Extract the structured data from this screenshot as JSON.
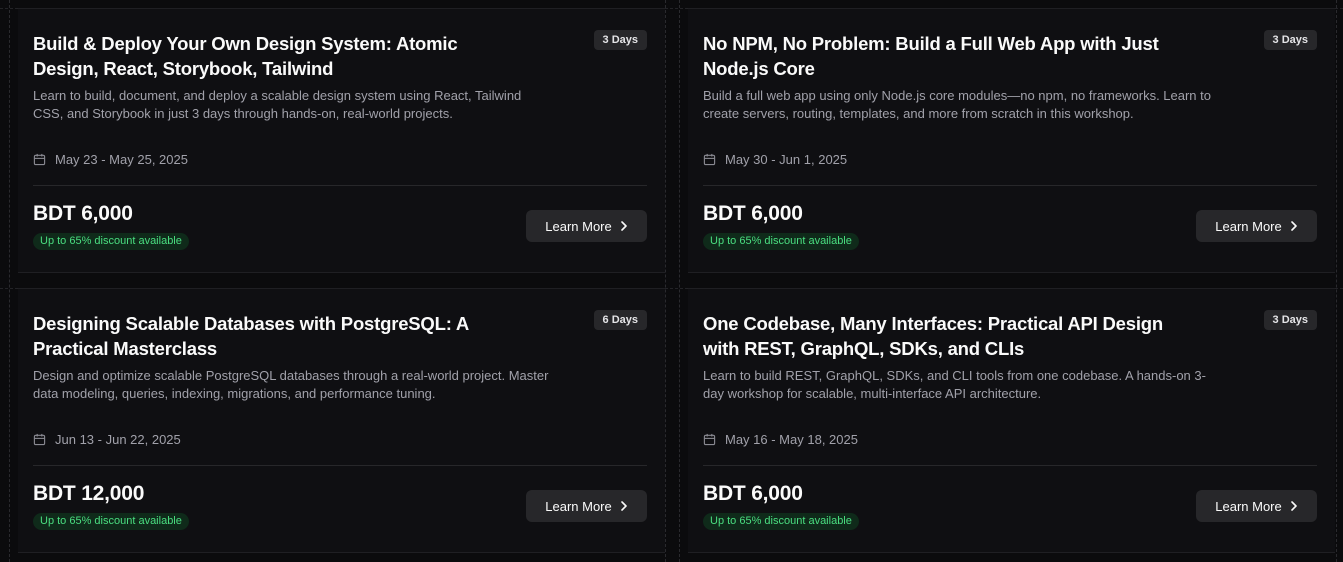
{
  "cards": [
    {
      "title": "Build & Deploy Your Own Design System: Atomic Design, React, Storybook, Tailwind",
      "badge": "3 Days",
      "description": "Learn to build, document, and deploy a scalable design system using React, Tailwind CSS, and Storybook in just 3 days through hands-on, real-world projects.",
      "date": "May 23 - May 25, 2025",
      "price": "BDT 6,000",
      "discount": "Up to 65% discount available",
      "cta": "Learn More"
    },
    {
      "title": "No NPM, No Problem: Build a Full Web App with Just Node.js Core",
      "badge": "3 Days",
      "description": "Build a full web app using only Node.js core modules—no npm, no frameworks. Learn to create servers, routing, templates, and more from scratch in this workshop.",
      "date": "May 30 - Jun 1, 2025",
      "price": "BDT 6,000",
      "discount": "Up to 65% discount available",
      "cta": "Learn More"
    },
    {
      "title": "Designing Scalable Databases with PostgreSQL: A Practical Masterclass",
      "badge": "6 Days",
      "description": "Design and optimize scalable PostgreSQL databases through a real-world project. Master data modeling, queries, indexing, migrations, and performance tuning.",
      "date": "Jun 13 - Jun 22, 2025",
      "price": "BDT 12,000",
      "discount": "Up to 65% discount available",
      "cta": "Learn More"
    },
    {
      "title": "One Codebase, Many Interfaces: Practical API Design with REST, GraphQL, SDKs, and CLIs",
      "badge": "3 Days",
      "description": "Learn to build REST, GraphQL, SDKs, and CLI tools from one codebase. A hands-on 3-day workshop for scalable, multi-interface API architecture.",
      "date": "May 16 - May 18, 2025",
      "price": "BDT 6,000",
      "discount": "Up to 65% discount available",
      "cta": "Learn More"
    }
  ],
  "icons": {
    "date": "calendar-icon",
    "cta": "chevron-right-icon"
  },
  "colors": {
    "background": "#0b0b0d",
    "card": "#0f0f12",
    "discount_text": "#4ade80",
    "discount_bg": "#0f2a1a",
    "button": "#27272a"
  }
}
